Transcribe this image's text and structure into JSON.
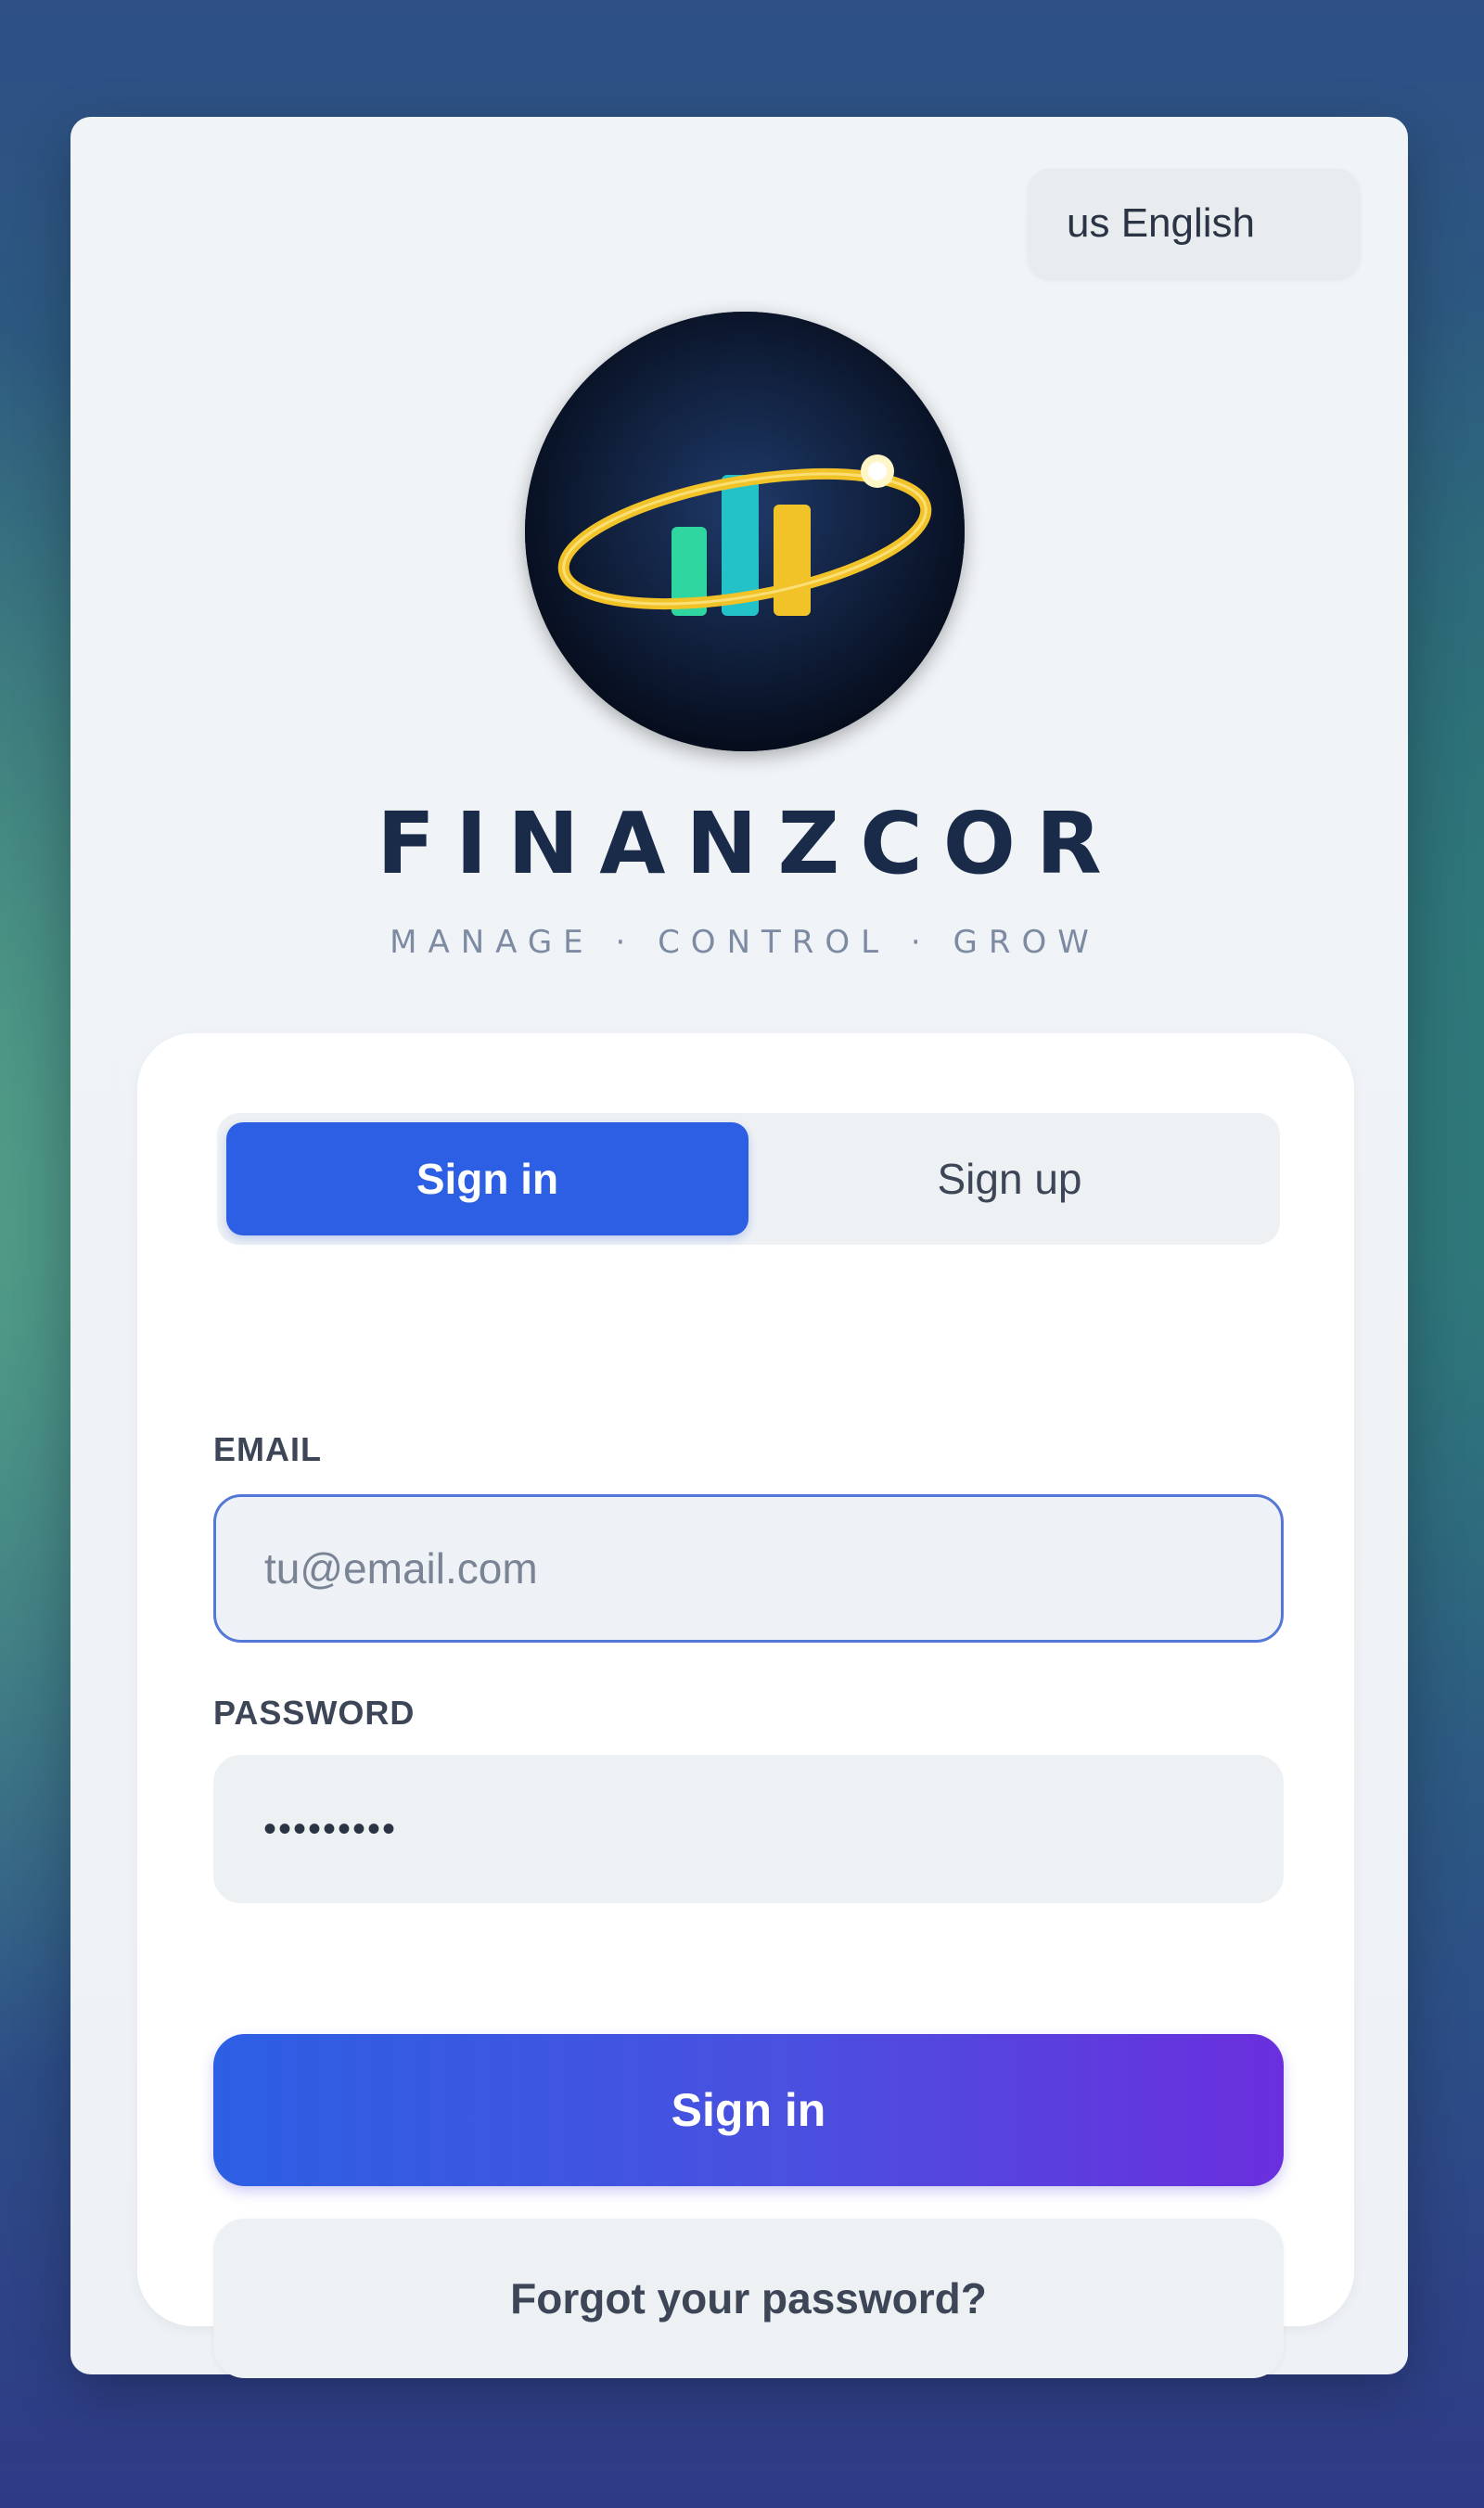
{
  "language": {
    "label": "us English"
  },
  "brand": {
    "name": "FINANZCOR",
    "tagline": "MANAGE · CONTROL · GROW"
  },
  "tabs": [
    {
      "label": "Sign in",
      "active": true
    },
    {
      "label": "Sign up",
      "active": false
    }
  ],
  "form": {
    "email_label": "EMAIL",
    "email_placeholder": "tu@email.com",
    "email_value": "",
    "password_label": "PASSWORD",
    "password_value": "•••••••••",
    "submit_label": "Sign in",
    "forgot_label": "Forgot your password?"
  },
  "colors": {
    "primary": "#2c5fe3",
    "gradient_end": "#6a2fdd",
    "brand_text": "#1a2b4a",
    "logo_bg": "#0c1a33",
    "logo_ring": "#f2c229",
    "bar_green": "#2fd6a0",
    "bar_teal": "#23c2c9",
    "bar_yellow": "#f2c229"
  },
  "icons": {
    "logo": "finance-bar-chart-orbit-logo"
  }
}
